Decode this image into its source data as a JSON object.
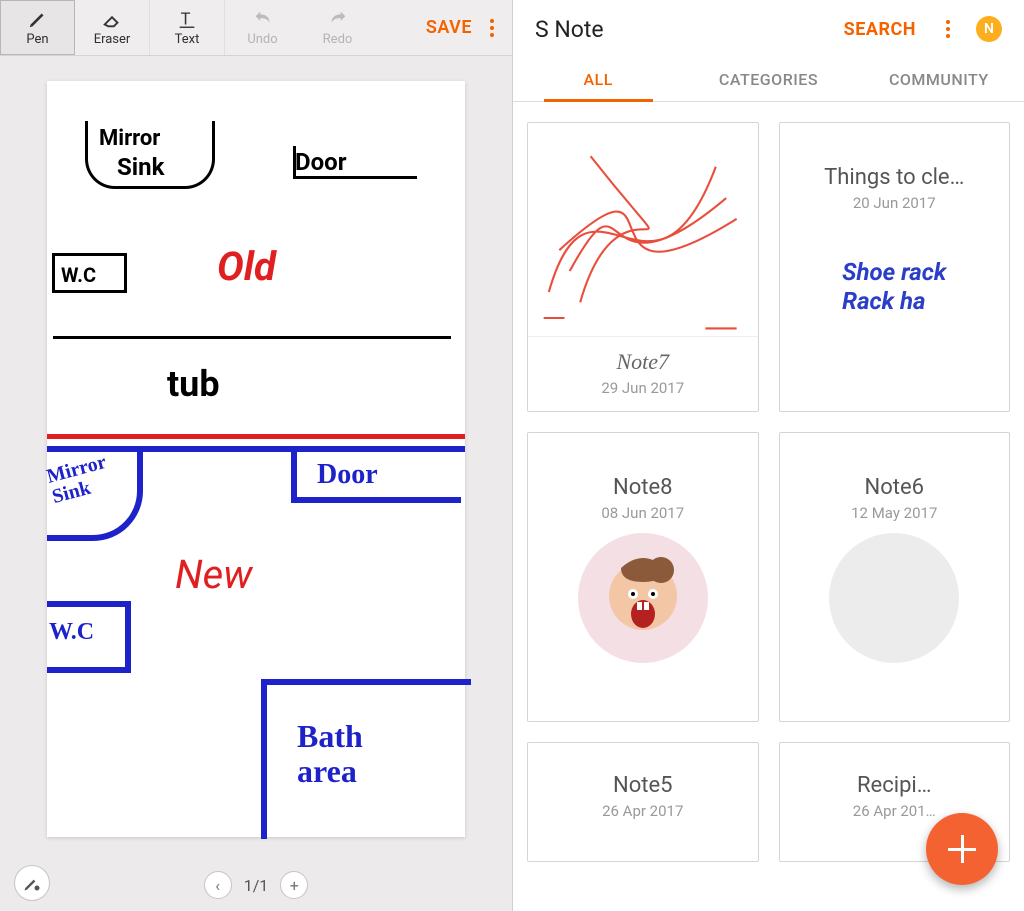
{
  "editor": {
    "tools": {
      "pen": "Pen",
      "eraser": "Eraser",
      "text": "Text",
      "undo": "Undo",
      "redo": "Redo"
    },
    "save": "SAVE",
    "pager": {
      "current": "1/1"
    },
    "canvas_ink": {
      "mirror": "Mirror",
      "sink": "Sink",
      "door_top": "Door",
      "wc": "W.C",
      "old": "Old",
      "tub": "tub",
      "mirror_sink_new": "Mirror\nSink",
      "door_new": "Door",
      "wc_new": "W.C",
      "new": "New",
      "bath_area": "Bath\narea"
    }
  },
  "snote": {
    "app_title": "S Note",
    "search": "SEARCH",
    "avatar": "N",
    "tabs": {
      "all": "ALL",
      "categories": "CATEGORIES",
      "community": "COMMUNITY"
    },
    "cards": [
      {
        "title": "Note7",
        "date": "29 Jun 2017"
      },
      {
        "title": "Things to cle…",
        "date": "20 Jun 2017",
        "hand_lines": [
          "Shoe rack",
          "Rack ha"
        ]
      },
      {
        "title": "Note8",
        "date": "08 Jun 2017"
      },
      {
        "title": "Note6",
        "date": "12 May 2017"
      },
      {
        "title": "Note5",
        "date": "26 Apr 2017"
      },
      {
        "title": "Recipi…",
        "date": "26 Apr 201…"
      }
    ]
  }
}
